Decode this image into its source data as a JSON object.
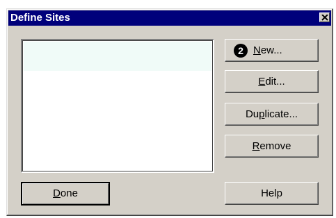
{
  "window": {
    "title": "Define Sites",
    "close_glyph": "×"
  },
  "site_list": {
    "items": []
  },
  "buttons": {
    "new_badge": "2",
    "new_accel": "N",
    "new_rest": "ew...",
    "edit_accel": "E",
    "edit_rest": "dit...",
    "duplicate_pre": "Du",
    "duplicate_accel": "p",
    "duplicate_rest": "licate...",
    "remove_accel": "R",
    "remove_rest": "emove",
    "done_accel": "D",
    "done_rest": "one",
    "help_label": "Help"
  },
  "icons": {
    "close": "close-icon",
    "badge": "step-2-badge-icon"
  },
  "colors": {
    "titlebar": "#00007b",
    "face": "#d4d0c8",
    "list_bg": "#ffffff"
  }
}
